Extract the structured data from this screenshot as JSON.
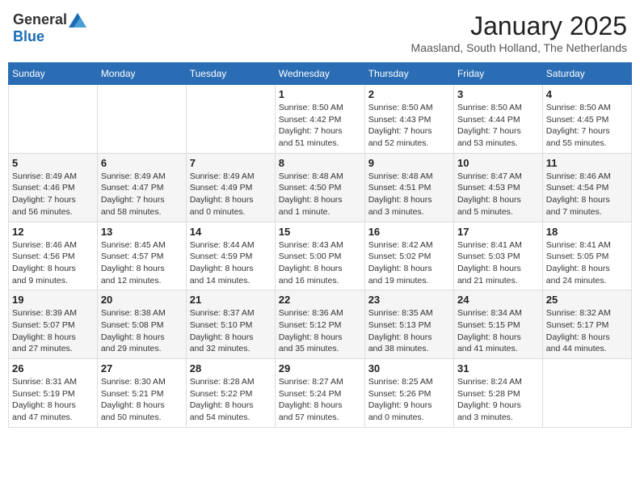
{
  "logo": {
    "general": "General",
    "blue": "Blue"
  },
  "title": "January 2025",
  "location": "Maasland, South Holland, The Netherlands",
  "days_of_week": [
    "Sunday",
    "Monday",
    "Tuesday",
    "Wednesday",
    "Thursday",
    "Friday",
    "Saturday"
  ],
  "weeks": [
    [
      {
        "day": "",
        "info": ""
      },
      {
        "day": "",
        "info": ""
      },
      {
        "day": "",
        "info": ""
      },
      {
        "day": "1",
        "info": "Sunrise: 8:50 AM\nSunset: 4:42 PM\nDaylight: 7 hours\nand 51 minutes."
      },
      {
        "day": "2",
        "info": "Sunrise: 8:50 AM\nSunset: 4:43 PM\nDaylight: 7 hours\nand 52 minutes."
      },
      {
        "day": "3",
        "info": "Sunrise: 8:50 AM\nSunset: 4:44 PM\nDaylight: 7 hours\nand 53 minutes."
      },
      {
        "day": "4",
        "info": "Sunrise: 8:50 AM\nSunset: 4:45 PM\nDaylight: 7 hours\nand 55 minutes."
      }
    ],
    [
      {
        "day": "5",
        "info": "Sunrise: 8:49 AM\nSunset: 4:46 PM\nDaylight: 7 hours\nand 56 minutes."
      },
      {
        "day": "6",
        "info": "Sunrise: 8:49 AM\nSunset: 4:47 PM\nDaylight: 7 hours\nand 58 minutes."
      },
      {
        "day": "7",
        "info": "Sunrise: 8:49 AM\nSunset: 4:49 PM\nDaylight: 8 hours\nand 0 minutes."
      },
      {
        "day": "8",
        "info": "Sunrise: 8:48 AM\nSunset: 4:50 PM\nDaylight: 8 hours\nand 1 minute."
      },
      {
        "day": "9",
        "info": "Sunrise: 8:48 AM\nSunset: 4:51 PM\nDaylight: 8 hours\nand 3 minutes."
      },
      {
        "day": "10",
        "info": "Sunrise: 8:47 AM\nSunset: 4:53 PM\nDaylight: 8 hours\nand 5 minutes."
      },
      {
        "day": "11",
        "info": "Sunrise: 8:46 AM\nSunset: 4:54 PM\nDaylight: 8 hours\nand 7 minutes."
      }
    ],
    [
      {
        "day": "12",
        "info": "Sunrise: 8:46 AM\nSunset: 4:56 PM\nDaylight: 8 hours\nand 9 minutes."
      },
      {
        "day": "13",
        "info": "Sunrise: 8:45 AM\nSunset: 4:57 PM\nDaylight: 8 hours\nand 12 minutes."
      },
      {
        "day": "14",
        "info": "Sunrise: 8:44 AM\nSunset: 4:59 PM\nDaylight: 8 hours\nand 14 minutes."
      },
      {
        "day": "15",
        "info": "Sunrise: 8:43 AM\nSunset: 5:00 PM\nDaylight: 8 hours\nand 16 minutes."
      },
      {
        "day": "16",
        "info": "Sunrise: 8:42 AM\nSunset: 5:02 PM\nDaylight: 8 hours\nand 19 minutes."
      },
      {
        "day": "17",
        "info": "Sunrise: 8:41 AM\nSunset: 5:03 PM\nDaylight: 8 hours\nand 21 minutes."
      },
      {
        "day": "18",
        "info": "Sunrise: 8:41 AM\nSunset: 5:05 PM\nDaylight: 8 hours\nand 24 minutes."
      }
    ],
    [
      {
        "day": "19",
        "info": "Sunrise: 8:39 AM\nSunset: 5:07 PM\nDaylight: 8 hours\nand 27 minutes."
      },
      {
        "day": "20",
        "info": "Sunrise: 8:38 AM\nSunset: 5:08 PM\nDaylight: 8 hours\nand 29 minutes."
      },
      {
        "day": "21",
        "info": "Sunrise: 8:37 AM\nSunset: 5:10 PM\nDaylight: 8 hours\nand 32 minutes."
      },
      {
        "day": "22",
        "info": "Sunrise: 8:36 AM\nSunset: 5:12 PM\nDaylight: 8 hours\nand 35 minutes."
      },
      {
        "day": "23",
        "info": "Sunrise: 8:35 AM\nSunset: 5:13 PM\nDaylight: 8 hours\nand 38 minutes."
      },
      {
        "day": "24",
        "info": "Sunrise: 8:34 AM\nSunset: 5:15 PM\nDaylight: 8 hours\nand 41 minutes."
      },
      {
        "day": "25",
        "info": "Sunrise: 8:32 AM\nSunset: 5:17 PM\nDaylight: 8 hours\nand 44 minutes."
      }
    ],
    [
      {
        "day": "26",
        "info": "Sunrise: 8:31 AM\nSunset: 5:19 PM\nDaylight: 8 hours\nand 47 minutes."
      },
      {
        "day": "27",
        "info": "Sunrise: 8:30 AM\nSunset: 5:21 PM\nDaylight: 8 hours\nand 50 minutes."
      },
      {
        "day": "28",
        "info": "Sunrise: 8:28 AM\nSunset: 5:22 PM\nDaylight: 8 hours\nand 54 minutes."
      },
      {
        "day": "29",
        "info": "Sunrise: 8:27 AM\nSunset: 5:24 PM\nDaylight: 8 hours\nand 57 minutes."
      },
      {
        "day": "30",
        "info": "Sunrise: 8:25 AM\nSunset: 5:26 PM\nDaylight: 9 hours\nand 0 minutes."
      },
      {
        "day": "31",
        "info": "Sunrise: 8:24 AM\nSunset: 5:28 PM\nDaylight: 9 hours\nand 3 minutes."
      },
      {
        "day": "",
        "info": ""
      }
    ]
  ]
}
